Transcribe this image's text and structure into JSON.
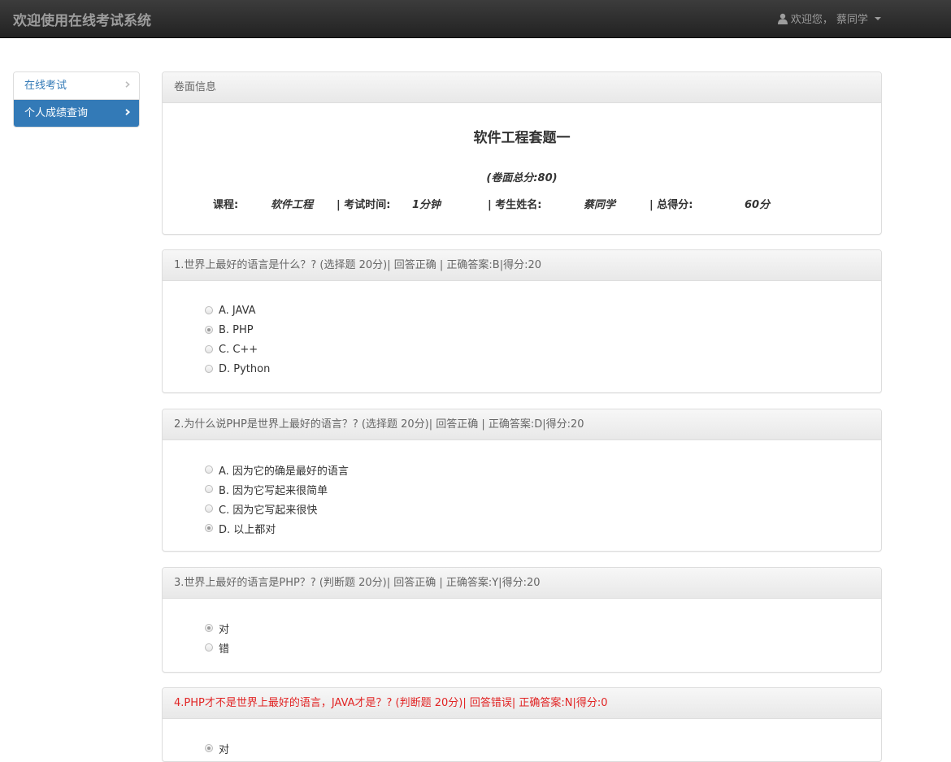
{
  "header": {
    "brand": "欢迎使用在线考试系统",
    "user_label": "欢迎您， 蔡同学"
  },
  "sidebar": {
    "items": [
      {
        "label": "在线考试"
      },
      {
        "label": "个人成绩查询"
      }
    ]
  },
  "paper": {
    "panel_title": "卷面信息",
    "title": "软件工程套题一",
    "total": "(卷面总分:80)",
    "course_label": "课程:",
    "course_value": "软件工程",
    "time_label": "| 考试时间:",
    "time_value": "1分钟",
    "student_label": "| 考生姓名:",
    "student_value": "蔡同学",
    "score_label": "| 总得分:",
    "score_value": "60分"
  },
  "questions": [
    {
      "header": "1.世界上最好的语言是什么？? (选择题 20分)| 回答正确 | 正确答案:B|得分:20",
      "options": [
        "A. JAVA",
        "B. PHP",
        "C. C++",
        "D. Python"
      ],
      "selected": 1
    },
    {
      "header": "2.为什么说PHP是世界上最好的语言？? (选择题 20分)| 回答正确 | 正确答案:D|得分:20",
      "options": [
        "A. 因为它的确是最好的语言",
        "B. 因为它写起来很简单",
        "C. 因为它写起来很快",
        "D. 以上都对"
      ],
      "selected": 3
    },
    {
      "header": "3.世界上最好的语言是PHP？? (判断题 20分)| 回答正确 | 正确答案:Y|得分:20",
      "options": [
        "对",
        "错"
      ],
      "selected": 0
    },
    {
      "header": "4.PHP才不是世界上最好的语言，JAVA才是？? (判断题 20分)| 回答错误| 正确答案:N|得分:0",
      "options": [
        "对"
      ],
      "selected": 0,
      "status_color": "#e12424"
    }
  ],
  "colors": {
    "primary": "#337ab7",
    "wrong": "#e12424"
  }
}
